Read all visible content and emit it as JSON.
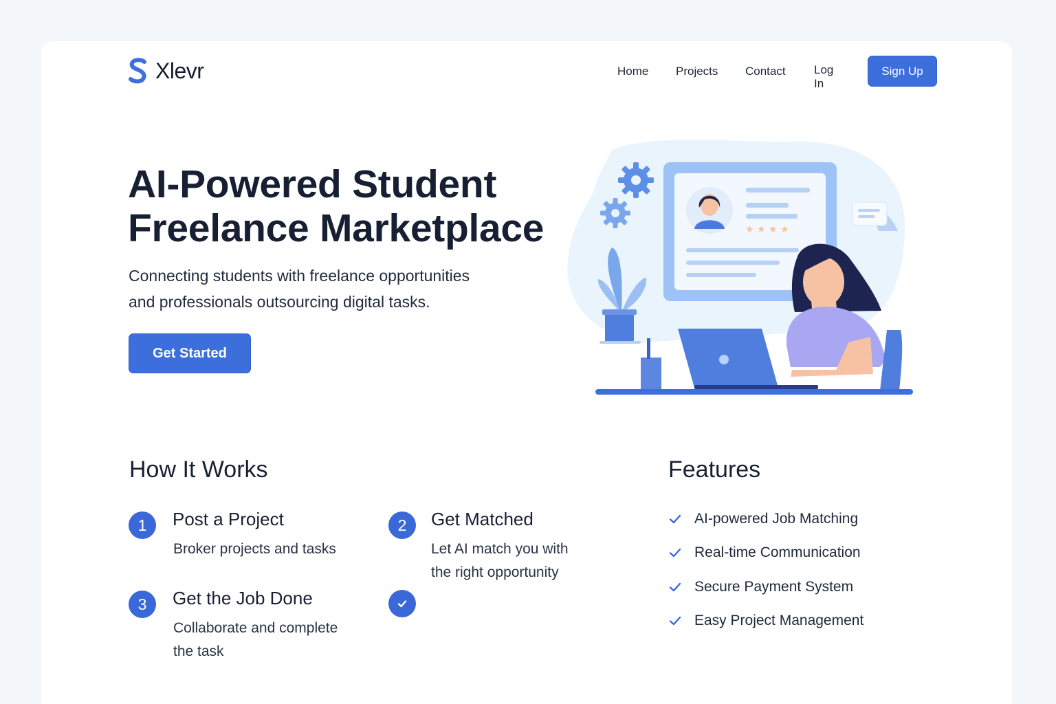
{
  "brand": {
    "name": "Xlevr",
    "accent": "#3d6fdc"
  },
  "nav": {
    "home": "Home",
    "projects": "Projects",
    "contact": "Contact",
    "login": "Log In",
    "signup": "Sign Up"
  },
  "hero": {
    "title_line1": "AI-Powered Student",
    "title_line2": "Freelance Marketplace",
    "subtitle_line1": "Connecting students with freelance opportunities",
    "subtitle_line2": "and professionals outsourcing digital tasks.",
    "cta": "Get Started",
    "illustration_icon": "student-laptop-illustration"
  },
  "how": {
    "title": "How It Works",
    "steps": [
      {
        "num": "1",
        "title": "Post a Project",
        "desc_line1": "Broker projects and tasks",
        "desc_line2": ""
      },
      {
        "num": "2",
        "title": "Get Matched",
        "desc_line1": "Let AI match you with",
        "desc_line2": "the right opportunity"
      },
      {
        "num": "3",
        "title": "Get the Job Done",
        "desc_line1": "Collaborate and complete",
        "desc_line2": "the task"
      }
    ]
  },
  "features": {
    "title": "Features",
    "items": [
      "AI-powered Job Matching",
      "Real-time Communication",
      "Secure Payment System",
      "Easy Project Management"
    ]
  }
}
